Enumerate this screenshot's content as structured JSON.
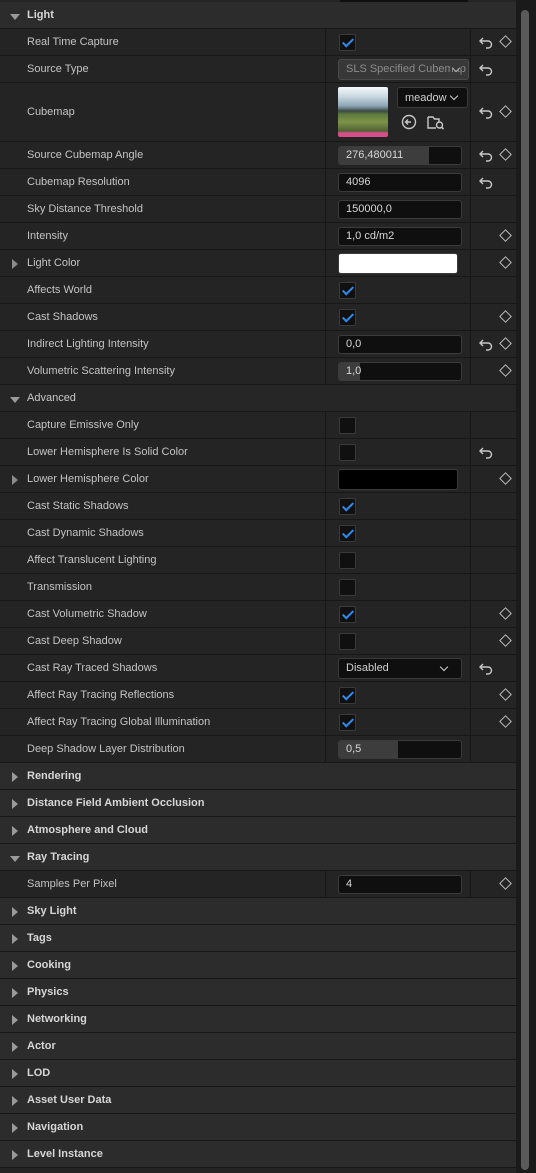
{
  "light": {
    "title": "Light",
    "real_time_capture": {
      "label": "Real Time Capture",
      "checked": true
    },
    "source_type": {
      "label": "Source Type",
      "value": "SLS Specified Cubemap"
    },
    "cubemap": {
      "label": "Cubemap",
      "asset": "meadow"
    },
    "source_cubemap_angle": {
      "label": "Source Cubemap Angle",
      "value": "276,480011",
      "fill": 0.74
    },
    "cubemap_resolution": {
      "label": "Cubemap Resolution",
      "value": "4096"
    },
    "sky_distance_threshold": {
      "label": "Sky Distance Threshold",
      "value": "150000,0"
    },
    "intensity": {
      "label": "Intensity",
      "value": "1,0 cd/m2"
    },
    "light_color": {
      "label": "Light Color",
      "color": "#ffffff"
    },
    "affects_world": {
      "label": "Affects World",
      "checked": true
    },
    "cast_shadows": {
      "label": "Cast Shadows",
      "checked": true
    },
    "indirect_lighting_intensity": {
      "label": "Indirect Lighting Intensity",
      "value": "0,0"
    },
    "volumetric_scattering_intensity": {
      "label": "Volumetric Scattering Intensity",
      "value": "1,0",
      "fill": 0.17
    }
  },
  "advanced": {
    "title": "Advanced",
    "capture_emissive_only": {
      "label": "Capture Emissive Only",
      "checked": false
    },
    "lower_hemisphere_solid": {
      "label": "Lower Hemisphere Is Solid Color",
      "checked": false
    },
    "lower_hemisphere_color": {
      "label": "Lower Hemisphere Color",
      "color": "#000000"
    },
    "cast_static_shadows": {
      "label": "Cast Static Shadows",
      "checked": true
    },
    "cast_dynamic_shadows": {
      "label": "Cast Dynamic Shadows",
      "checked": true
    },
    "affect_translucent_lighting": {
      "label": "Affect Translucent Lighting",
      "checked": false
    },
    "transmission": {
      "label": "Transmission",
      "checked": false
    },
    "cast_volumetric_shadow": {
      "label": "Cast Volumetric Shadow",
      "checked": true
    },
    "cast_deep_shadow": {
      "label": "Cast Deep Shadow",
      "checked": false
    },
    "cast_ray_traced_shadows": {
      "label": "Cast Ray Traced Shadows",
      "value": "Disabled"
    },
    "affect_rt_reflections": {
      "label": "Affect Ray Tracing Reflections",
      "checked": true
    },
    "affect_rt_gi": {
      "label": "Affect Ray Tracing Global Illumination",
      "checked": true
    },
    "deep_shadow_layer_distribution": {
      "label": "Deep Shadow Layer Distribution",
      "value": "0,5",
      "fill": 0.48
    }
  },
  "categories": {
    "rendering": "Rendering",
    "dfao": "Distance Field Ambient Occlusion",
    "atmosphere": "Atmosphere and Cloud",
    "ray_tracing": "Ray Tracing",
    "sky_light": "Sky Light",
    "tags": "Tags",
    "cooking": "Cooking",
    "physics": "Physics",
    "networking": "Networking",
    "actor": "Actor",
    "lod": "LOD",
    "asset_user_data": "Asset User Data",
    "navigation": "Navigation",
    "level_instance": "Level Instance"
  },
  "ray_tracing": {
    "samples_per_pixel": {
      "label": "Samples Per Pixel",
      "value": "4"
    }
  },
  "icons": {
    "reset": "reset-to-default-icon",
    "keyframe": "keyframe-diamond-icon",
    "use_selected": "use-selected-asset-icon",
    "browse": "browse-asset-icon"
  },
  "colors": {
    "checkbox_accent": "#2e8cf0"
  }
}
